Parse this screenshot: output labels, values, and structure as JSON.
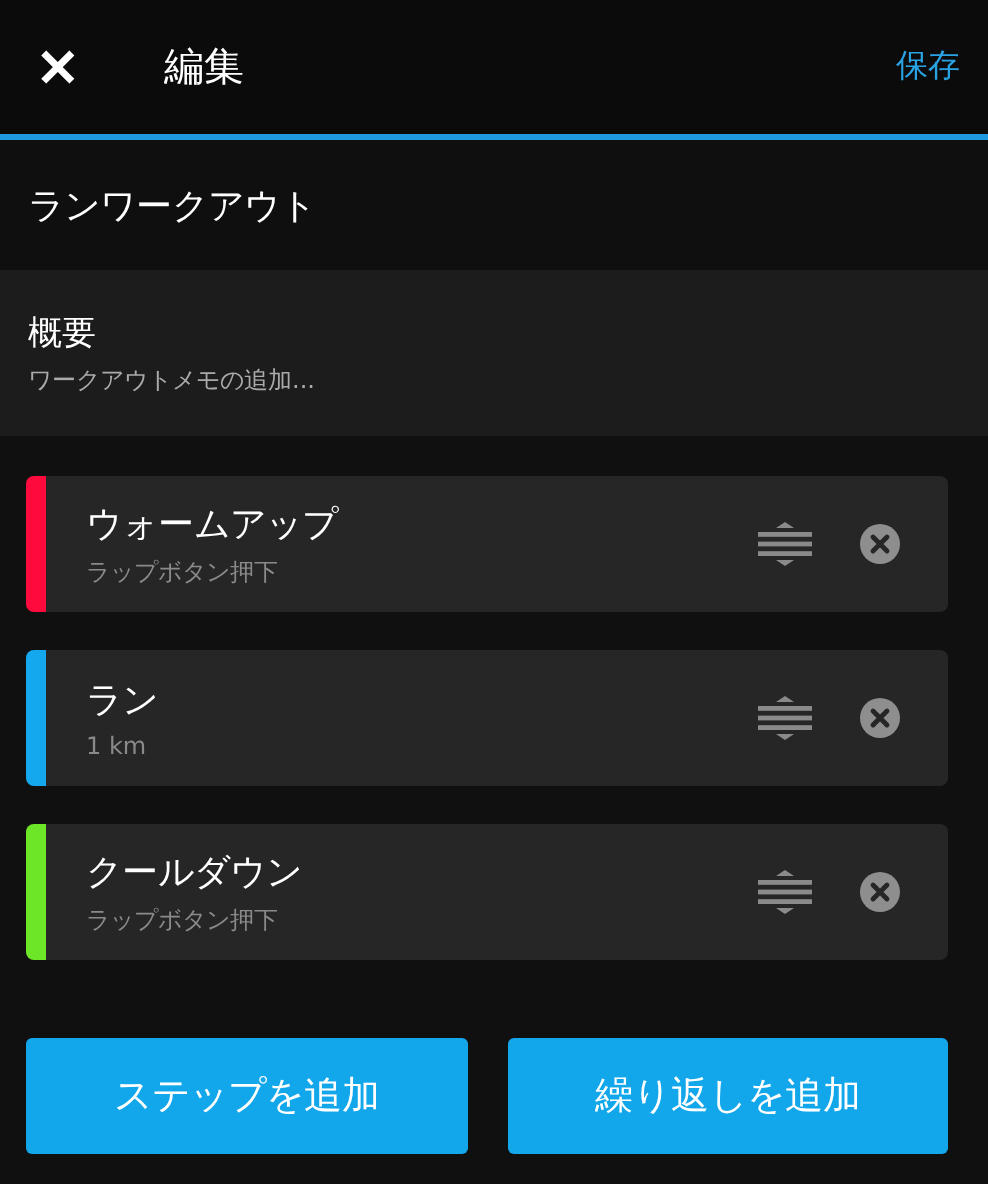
{
  "header": {
    "close": "✕",
    "title": "編集",
    "save": "保存"
  },
  "workout_name": "ランワークアウト",
  "summary": {
    "title": "概要",
    "placeholder": "ワークアウトメモの追加..."
  },
  "steps": [
    {
      "name": "ウォームアップ",
      "detail": "ラップボタン押下",
      "color": "#ff0a3c"
    },
    {
      "name": "ラン",
      "detail": "1 km",
      "color": "#14a8ee"
    },
    {
      "name": "クールダウン",
      "detail": "ラップボタン押下",
      "color": "#6ee628"
    }
  ],
  "buttons": [
    "ステップを追加",
    "繰り返しを追加"
  ]
}
